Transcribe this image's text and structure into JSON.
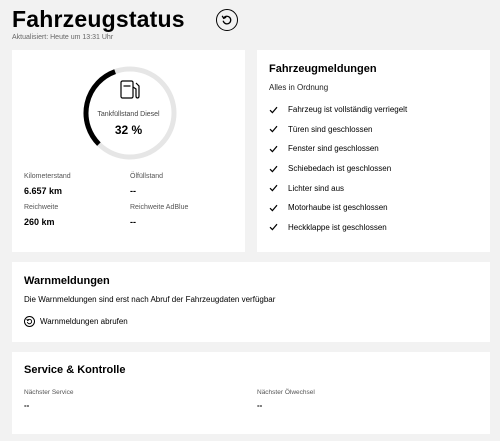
{
  "header": {
    "title": "Fahrzeugstatus",
    "updated": "Aktualisiert: Heute um 13:31 Uhr"
  },
  "fuel": {
    "label": "Tankfüllstand Diesel",
    "percent_text": "32 %",
    "percent": 32,
    "stats": {
      "mileage": {
        "label": "Kilometerstand",
        "value": "6.657 km"
      },
      "oil": {
        "label": "Ölfüllstand",
        "value": "--"
      },
      "range": {
        "label": "Reichweite",
        "value": "260 km"
      },
      "adblue_range": {
        "label": "Reichweite AdBlue",
        "value": "--"
      }
    }
  },
  "messages": {
    "title": "Fahrzeugmeldungen",
    "subtitle": "Alles in Ordnung",
    "items": [
      "Fahrzeug ist vollständig verriegelt",
      "Türen sind geschlossen",
      "Fenster sind geschlossen",
      "Schiebedach ist geschlossen",
      "Lichter sind aus",
      "Motorhaube ist geschlossen",
      "Heckklappe ist geschlossen"
    ]
  },
  "warnings": {
    "title": "Warnmeldungen",
    "text": "Die Warnmeldungen sind erst nach Abruf der Fahrzeugdaten verfügbar",
    "button": "Warnmeldungen abrufen"
  },
  "service": {
    "title": "Service & Kontrolle",
    "next_service": {
      "label": "Nächster Service",
      "value": "--"
    },
    "next_oil_change": {
      "label": "Nächster Ölwechsel",
      "value": "--"
    }
  },
  "colors": {
    "background": "#f2f2f2",
    "card": "#ffffff",
    "gauge_track": "#e6e6e6",
    "gauge_fill": "#000000"
  }
}
